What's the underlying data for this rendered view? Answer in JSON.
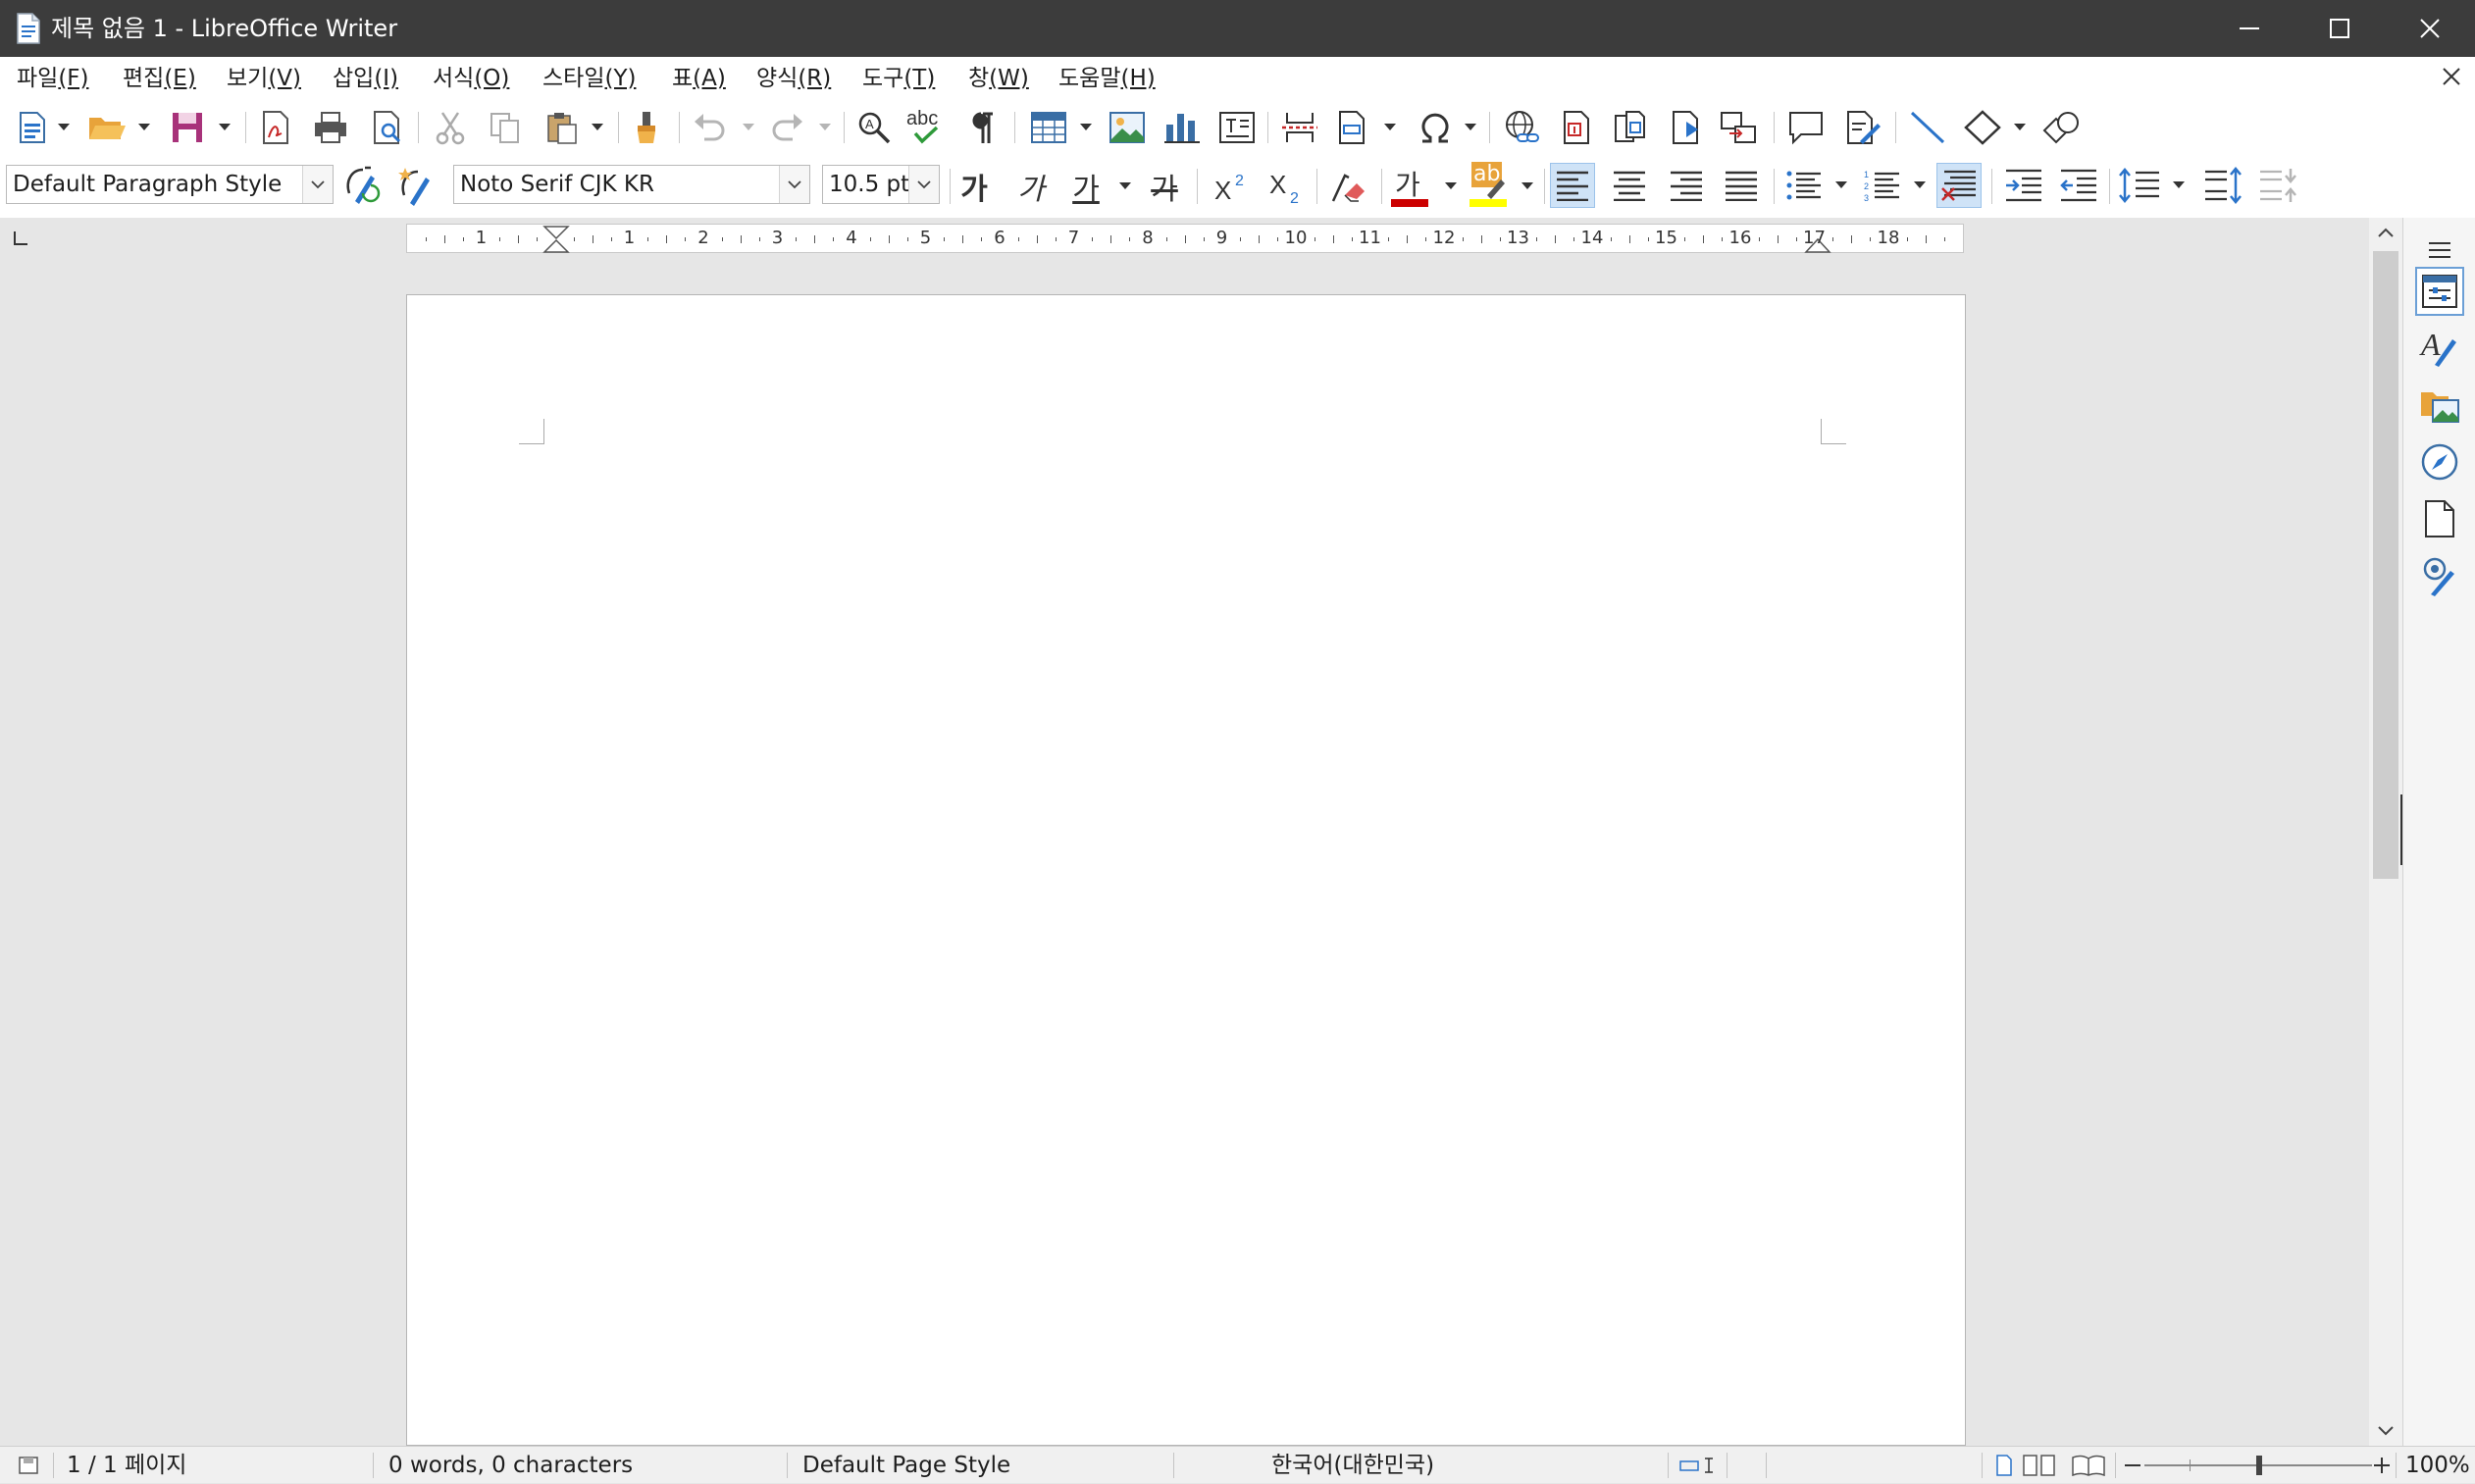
{
  "window": {
    "title": "제목 없음 1 - LibreOffice Writer"
  },
  "menu": [
    {
      "label": "파일",
      "key": "(F)"
    },
    {
      "label": "편집",
      "key": "(E)"
    },
    {
      "label": "보기",
      "key": "(V)"
    },
    {
      "label": "삽입",
      "key": "(I)"
    },
    {
      "label": "서식",
      "key": "(O)"
    },
    {
      "label": "스타일",
      "key": "(Y)"
    },
    {
      "label": "표",
      "key": "(A)"
    },
    {
      "label": "양식",
      "key": "(R)"
    },
    {
      "label": "도구",
      "key": "(T)"
    },
    {
      "label": "창",
      "key": "(W)"
    },
    {
      "label": "도움말",
      "key": "(H)"
    }
  ],
  "formatting": {
    "paragraph_style": "Default Paragraph Style",
    "font_name": "Noto Serif CJK KR",
    "font_size": "10.5 pt",
    "bold_glyph": "가",
    "italic_glyph": "가",
    "underline_glyph": "가",
    "strike_glyph": "가",
    "font_color_glyph": "가",
    "highlight_glyph": "ab",
    "spell_glyph": "abc",
    "font_color": "#cc0000",
    "highlight_color": "#ffff00"
  },
  "ruler": {
    "labels": [
      "1",
      "1",
      "2",
      "3",
      "4",
      "5",
      "6",
      "7",
      "8",
      "9",
      "10",
      "11",
      "12",
      "13",
      "14",
      "15",
      "16",
      "17",
      "18"
    ]
  },
  "status": {
    "page": "1 / 1 페이지",
    "words": "0 words, 0 characters",
    "page_style": "Default Page Style",
    "language": "한국어(대한민국)",
    "zoom": "100%"
  },
  "colors": {
    "titlebar": "#3c3c3c",
    "accent": "#1e6fc2",
    "active_button": "#cfe3f7"
  }
}
